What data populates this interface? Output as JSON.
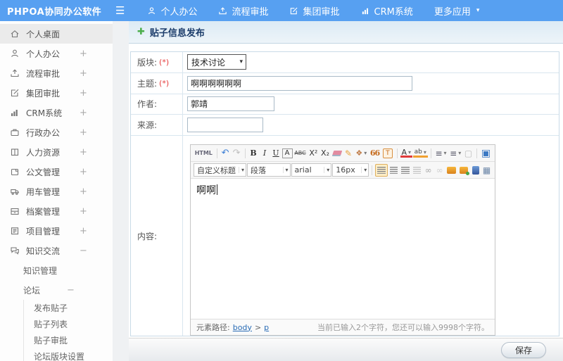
{
  "topbar": {
    "logo": "PHPOA协同办公软件",
    "menu_icon": "☰",
    "items": [
      {
        "label": "个人办公",
        "icon": "person-icon"
      },
      {
        "label": "流程审批",
        "icon": "flow-approval-icon"
      },
      {
        "label": "集团审批",
        "icon": "edit-square-icon"
      },
      {
        "label": "CRM系统",
        "icon": "bar-chart-icon"
      },
      {
        "label": "更多应用",
        "icon": "caret-down-icon"
      }
    ]
  },
  "sidebar": {
    "items": [
      {
        "label": "个人桌面",
        "icon": "home-icon",
        "expander": ""
      },
      {
        "label": "个人办公",
        "icon": "person-icon",
        "expander": "+"
      },
      {
        "label": "流程审批",
        "icon": "flow-approval-icon",
        "expander": "+"
      },
      {
        "label": "集团审批",
        "icon": "edit-square-icon",
        "expander": "+"
      },
      {
        "label": "CRM系统",
        "icon": "bar-chart-icon",
        "expander": "+"
      },
      {
        "label": "行政办公",
        "icon": "briefcase-icon",
        "expander": "+"
      },
      {
        "label": "人力资源",
        "icon": "book-icon",
        "expander": "+"
      },
      {
        "label": "公文管理",
        "icon": "document-icon",
        "expander": "+"
      },
      {
        "label": "用车管理",
        "icon": "truck-icon",
        "expander": "+"
      },
      {
        "label": "档案管理",
        "icon": "archive-icon",
        "expander": "+"
      },
      {
        "label": "项目管理",
        "icon": "clipboard-icon",
        "expander": "+"
      },
      {
        "label": "知识交流",
        "icon": "chat-icon",
        "expander": "−"
      }
    ],
    "submenu": {
      "knowledge": {
        "label": "知识管理",
        "expander": ""
      },
      "forum": {
        "label": "论坛",
        "expander": "−"
      },
      "forum_items": [
        {
          "label": "发布贴子"
        },
        {
          "label": "贴子列表"
        },
        {
          "label": "贴子审批"
        },
        {
          "label": "论坛版块设置"
        }
      ]
    }
  },
  "page": {
    "plus_icon": "✚",
    "title": "贴子信息发布"
  },
  "form": {
    "rows": [
      {
        "label": "版块:",
        "required": "(*)"
      },
      {
        "label": "主题:",
        "required": "(*)"
      },
      {
        "label": "作者:",
        "required": ""
      },
      {
        "label": "来源:",
        "required": ""
      },
      {
        "label": "内容:",
        "required": ""
      }
    ],
    "board_select_value": "技术讨论",
    "subject_value": "啊啊啊啊啊啊",
    "author_value": "郭靖",
    "source_value": "",
    "content_value": "啊啊"
  },
  "editor": {
    "toolbar1": {
      "html": "HTML",
      "undo": "↶",
      "redo": "↷",
      "bold": "B",
      "italic": "I",
      "underline": "U",
      "font_box": "A",
      "strike": "ABC",
      "sup": "X²",
      "sub": "X₂",
      "brush": "✎",
      "painter": "❖",
      "quote": "66",
      "date_box": "T",
      "fontcolor": "A",
      "highlight": "ab",
      "ordered_list": "≡",
      "unordered_list": "≡",
      "newpage": "▢",
      "fullscreen": "▣"
    },
    "toolbar2": {
      "style_select": "自定义标题",
      "para_select": "段落",
      "font_select": "arial",
      "size_select": "16px",
      "link": "∞",
      "unlink": "∞",
      "table": "▦"
    },
    "status": {
      "path_label": "元素路径:",
      "path_body": "body",
      "path_sep": ">",
      "path_p": "p",
      "counter": "当前已输入2个字符，您还可以输入9998个字符。"
    }
  },
  "footer": {
    "save_label": "保存"
  },
  "colors": {
    "topbar_blue": "#57a0f1",
    "title_text": "#1c3d6b",
    "plus_green": "#4cae4c",
    "required_red": "#e53b3b",
    "link_blue": "#2a6cb5",
    "align_active_bg": "#fdeec7"
  }
}
